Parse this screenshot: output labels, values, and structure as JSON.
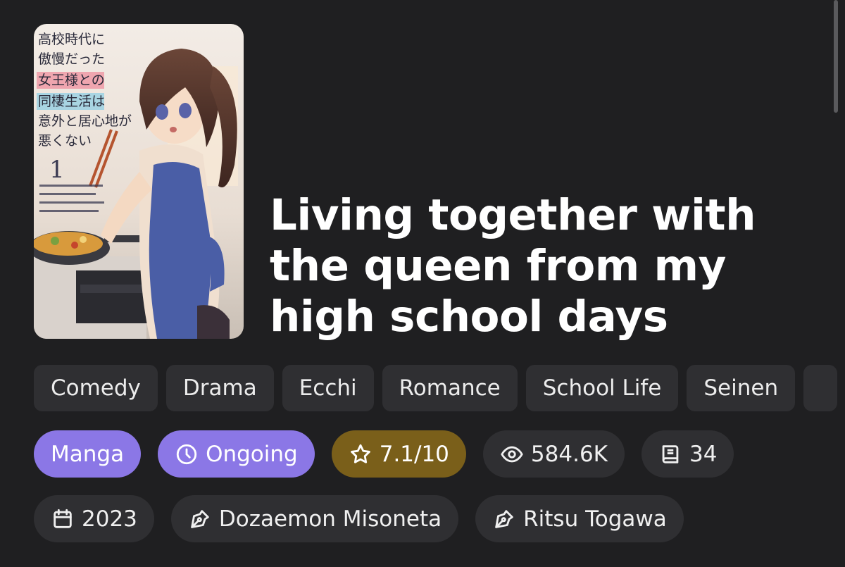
{
  "title": "Living together with the queen from my high school days",
  "cover": {
    "jp_lines": [
      "高校時代に",
      "傲慢だった",
      "女王様との",
      "同棲生活は",
      "意外と居心地が",
      "悪くない"
    ],
    "volume": "1"
  },
  "genres": [
    "Comedy",
    "Drama",
    "Ecchi",
    "Romance",
    "School Life",
    "Seinen"
  ],
  "stats": {
    "type": "Manga",
    "status": "Ongoing",
    "rating": "7.1/10",
    "views": "584.6K",
    "chapters": "34"
  },
  "meta": {
    "year": "2023",
    "author_1": "Dozaemon Misoneta",
    "author_2": "Ritsu Togawa"
  },
  "colors": {
    "background": "#1f1f21",
    "chip": "#2f2f32",
    "purple": "#8b77e6",
    "gold": "#7a5f1a"
  },
  "icons": {
    "status": "clock-icon",
    "rating": "star-icon",
    "views": "eye-icon",
    "chapters": "book-icon",
    "year": "calendar-icon",
    "author": "pen-nib-icon"
  }
}
